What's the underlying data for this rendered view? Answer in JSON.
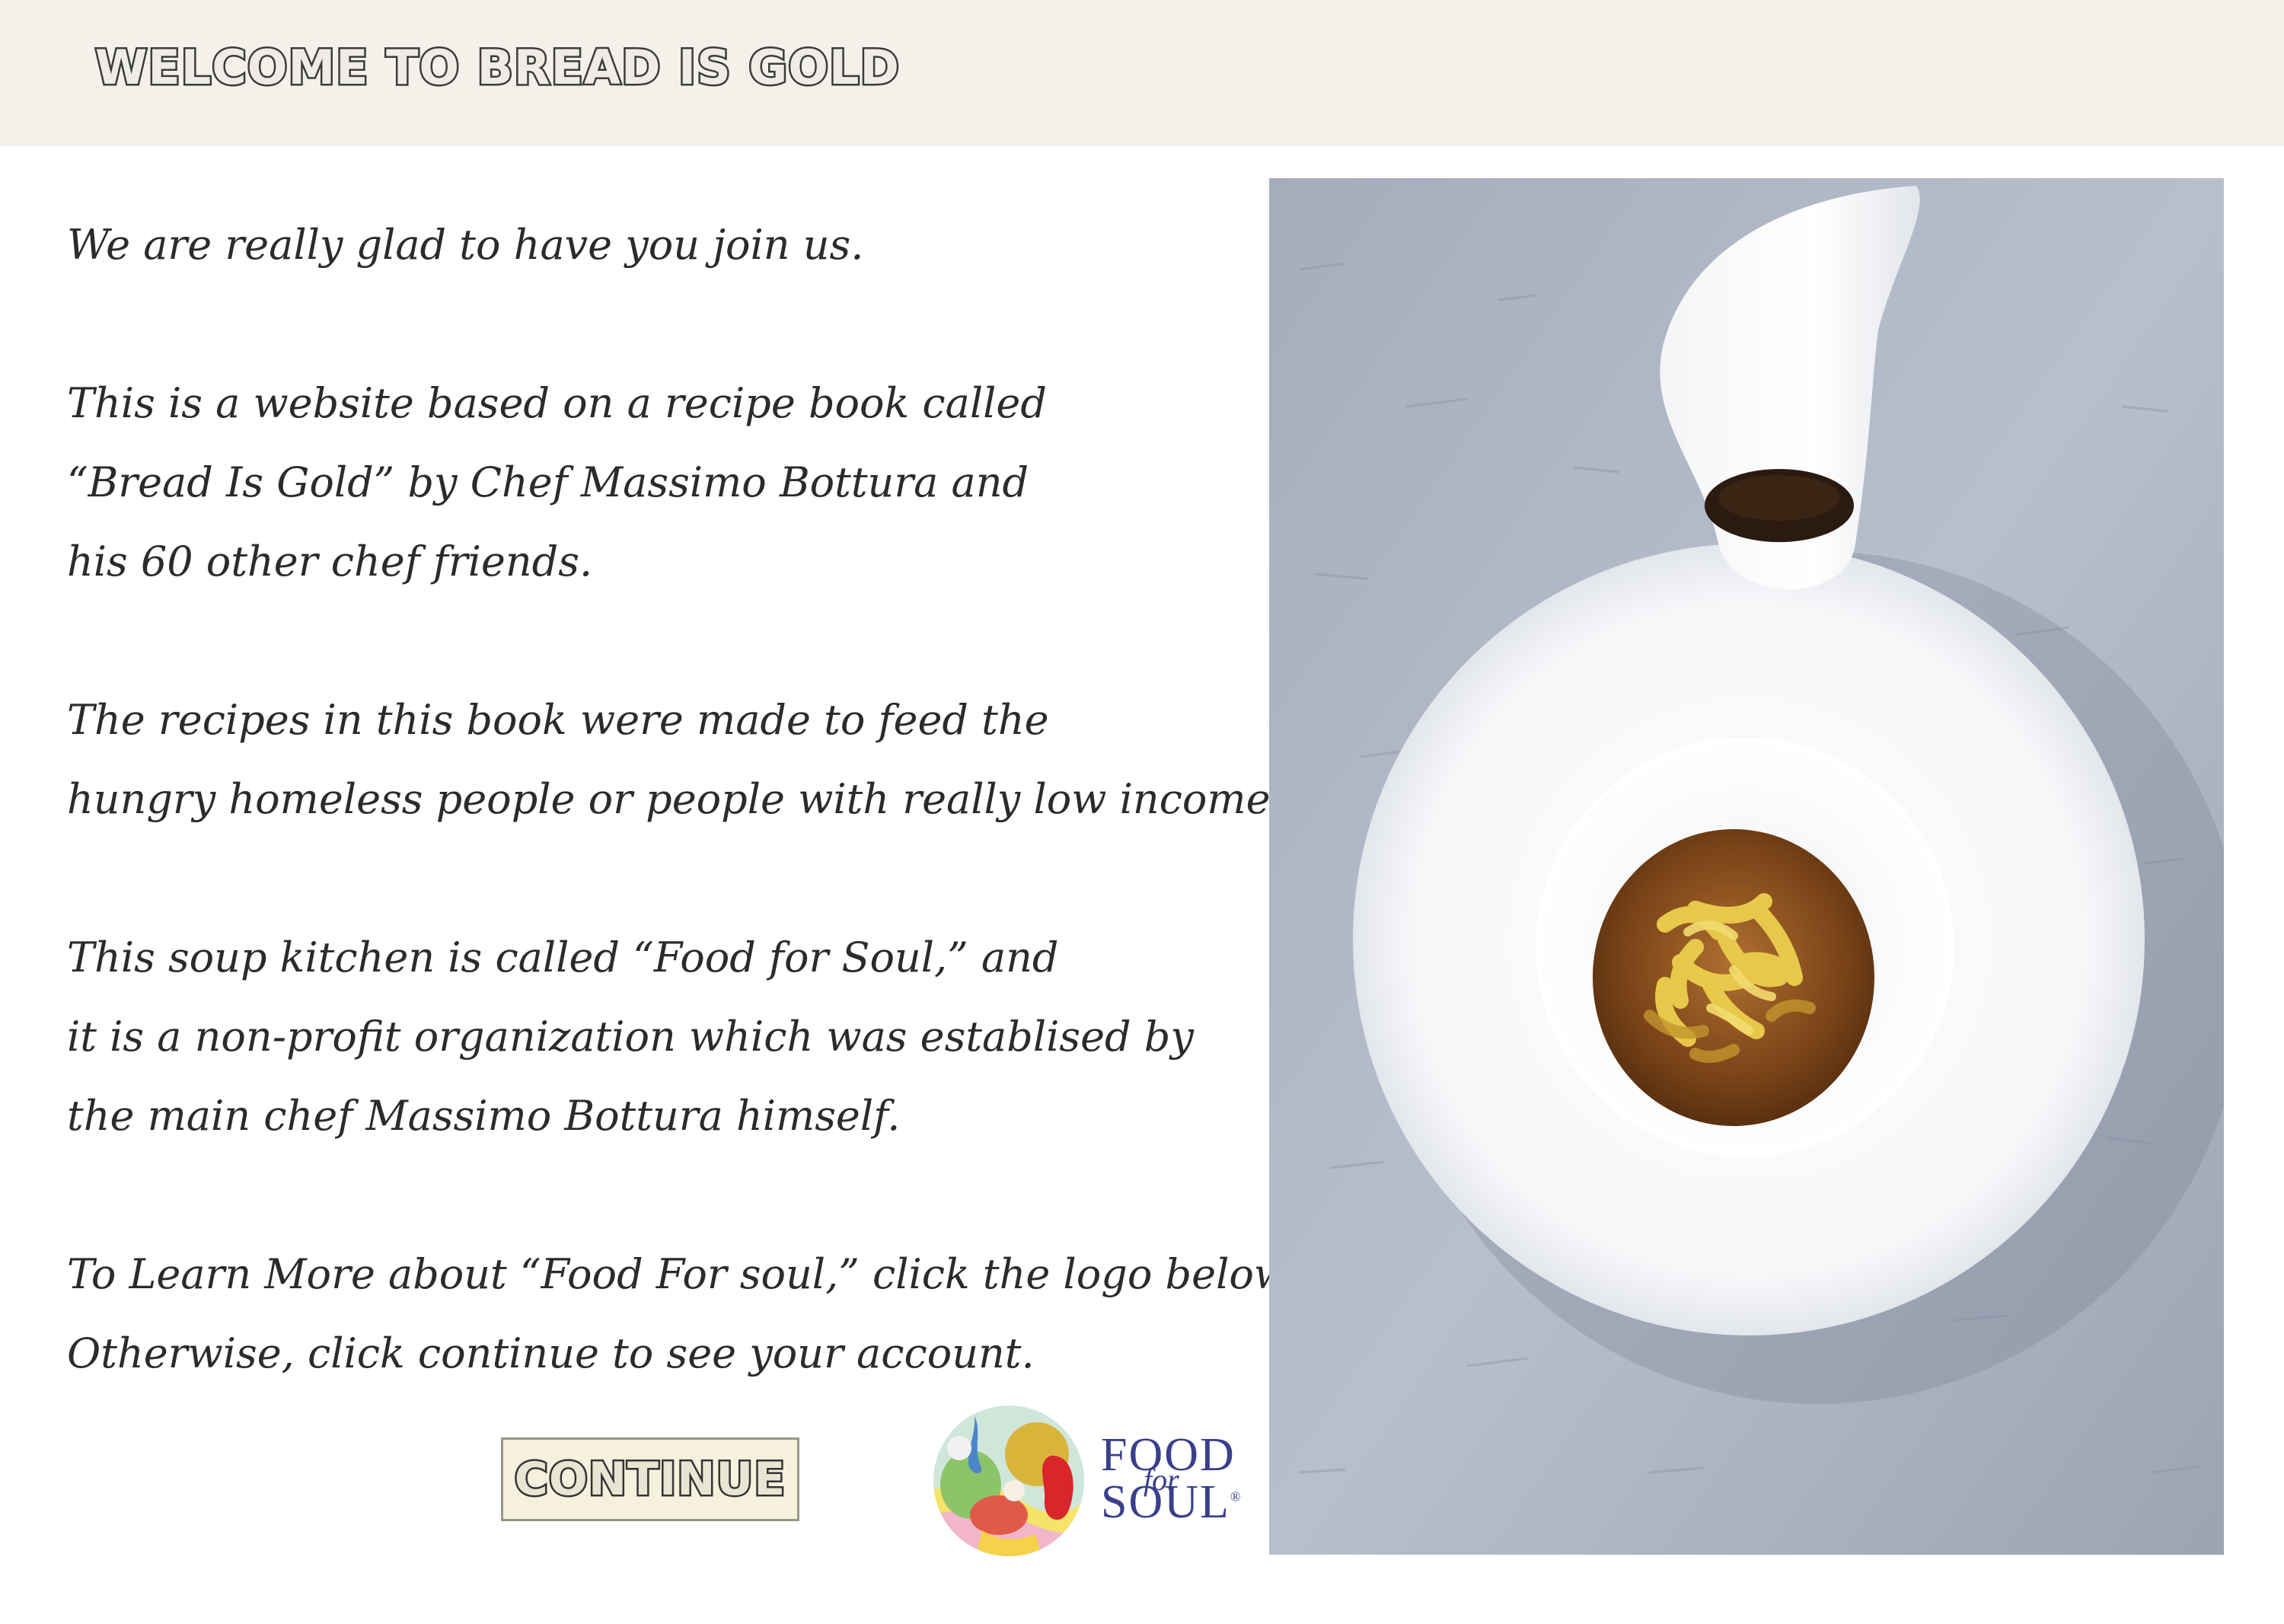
{
  "header": {
    "title": "Welcome to Bread Is Gold"
  },
  "intro": {
    "p1": [
      "We are really glad to have you join us."
    ],
    "p2": [
      "This is a website based on a recipe book called",
      "“Bread Is Gold” by Chef Massimo Bottura and",
      "his 60 other chef friends."
    ],
    "p3": [
      "The recipes in this book were made to feed the",
      "hungry homeless people or people with really low income."
    ],
    "p4": [
      "This soup kitchen is called “Food for Soul,” and",
      "it is a non-profit organization which was establised by",
      "the main chef Massimo Bottura himself."
    ],
    "p5": [
      "To Learn More about “Food For soul,” click the logo below.",
      "Otherwise, click continue to see your account."
    ]
  },
  "actions": {
    "continue_label": "CONTINUE"
  },
  "logo": {
    "line1": "FOOD",
    "line2": "for",
    "line3": "SOUL",
    "registered": "®",
    "text_color": "#3a3f8c"
  },
  "photo": {
    "subject": "plated dish with broth and fried pasta, small white pitcher"
  },
  "colors": {
    "header_bg": "#f3f1ea",
    "button_bg": "#f6f1dd",
    "text": "#2b2b2b"
  }
}
